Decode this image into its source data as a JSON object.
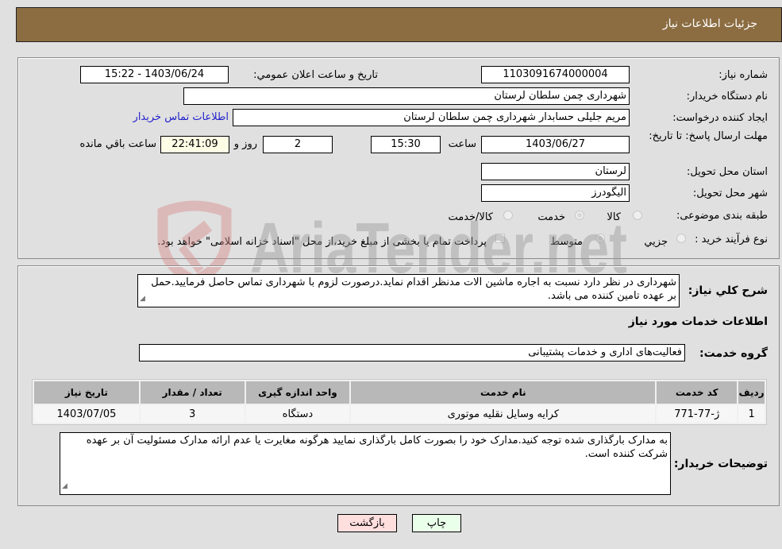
{
  "header": {
    "title": "جزئیات اطلاعات نیاز"
  },
  "form": {
    "need_number": {
      "label": "شماره نیاز:",
      "value": "1103091674000004"
    },
    "announce_datetime": {
      "label": "تاریخ و ساعت اعلان عمومي:",
      "value": "1403/06/24 - 15:22"
    },
    "buyer_org": {
      "label": "نام دستگاه خريدار:",
      "value": "شهرداری چمن سلطان لرستان"
    },
    "requester": {
      "label": "ايجاد کننده درخواست:",
      "value": "مریم جلیلی حسابدار شهرداری چمن سلطان لرستان",
      "contact_link": "اطلاعات تماس خريدار"
    },
    "deadline": {
      "label": "مهلت ارسال پاسخ: تا تاريخ:",
      "date": "1403/06/27",
      "time_label": "ساعت",
      "time": "15:30",
      "days": "2",
      "days_label": "روز و",
      "remaining": "22:41:09",
      "remaining_label": "ساعت باقي مانده"
    },
    "province": {
      "label": "استان محل تحويل:",
      "value": "لرستان"
    },
    "city": {
      "label": "شهر محل تحويل:",
      "value": "الیگودرز"
    },
    "category": {
      "label": "طبقه بندی موضوعی:",
      "options": [
        "کالا",
        "خدمت",
        "کالا/خدمت"
      ],
      "selected": "خدمت"
    },
    "purchase_type": {
      "label": "نوع فرآيند خريد :",
      "options": [
        "جزيي",
        "متوسط"
      ],
      "selected": "متوسط",
      "treasury_checkbox_label": "پرداخت تمام يا بخشی از مبلغ خريد،از محل \"اسناد خزانه اسلامی\" خواهد بود.",
      "treasury_checked": false
    }
  },
  "details": {
    "description_label": "شرح کلي نياز:",
    "description": "شهرداری در نظر دارد نسبت به اجاره ماشین الات مدنظر اقدام نماید.درصورت لزوم با شهرداری تماس حاصل فرمایید.حمل بر عهده تامین کننده می باشد.",
    "services_title": "اطلاعات خدمات مورد نياز",
    "service_group_label": "گروه خدمت:",
    "service_group": "فعاليت‌های اداری و خدمات پشتيبانی",
    "table": {
      "headers": [
        "رديف",
        "کد خدمت",
        "نام خدمت",
        "واحد اندازه گيری",
        "تعداد / مقدار",
        "تاريخ نياز"
      ],
      "rows": [
        [
          "1",
          "ژ-77-771",
          "کرایه وسایل نقلیه موتوری",
          "دستگاه",
          "3",
          "1403/07/05"
        ]
      ]
    },
    "buyer_notes_label": "توضيحات خريدار:",
    "buyer_notes": "به مدارک بارگذاری شده توجه کنید.مدارک خود را بصورت کامل بارگذاری نمایید هرگونه مغایرت یا عدم ارائه مدارک مسئولیت آن بر عهده شرکت کننده است."
  },
  "buttons": {
    "print": "چاپ",
    "back": "بازگشت"
  },
  "watermark": {
    "text": "AriaTender.net"
  },
  "colors": {
    "header_bg": "#8c6d42",
    "back_bg": "#ffdede",
    "print_bg": "#eaffea",
    "link": "#2222cc"
  }
}
